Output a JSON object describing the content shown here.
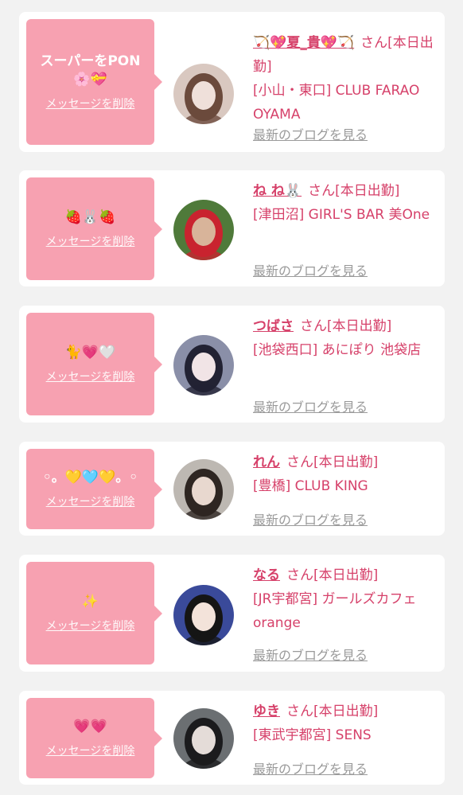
{
  "delete_label": "メッセージを削除",
  "blog_label": "最新のブログを見る",
  "honorific": "さん",
  "entries": [
    {
      "message": "スーパーをPON\n🌸💝",
      "name": "🏹💖夏_貴💖🏹",
      "status": "[本日出勤]",
      "shop": "[小山・東口] CLUB FARAO OYAMA",
      "avatar_colors": [
        "#d9c8c0",
        "#efe0da",
        "#6b4a3c"
      ]
    },
    {
      "message": "🍓🐰🍓",
      "name": "ね ね🐰",
      "status": "[本日出勤]",
      "shop": "[津田沼] GIRL'S BAR 美One",
      "avatar_colors": [
        "#4f7a3a",
        "#d8b49a",
        "#c9232f"
      ]
    },
    {
      "message": "🐈💗🤍",
      "name": "つばさ",
      "status": "[本日出勤]",
      "shop": "[池袋西口] あにぽり 池袋店",
      "avatar_colors": [
        "#8a8fa8",
        "#f1e4e6",
        "#222233"
      ]
    },
    {
      "message": "◦。💛🩵💛。◦",
      "name": "れん",
      "status": "[本日出勤]",
      "shop": "[豊橋] CLUB KING",
      "avatar_colors": [
        "#bdb8b2",
        "#e8d8cf",
        "#2e2622"
      ]
    },
    {
      "message": "✨",
      "name": "なる",
      "status": "[本日出勤]",
      "shop": "[JR宇都宮] ガールズカフェ orange",
      "avatar_colors": [
        "#3a4a9a",
        "#f3e3da",
        "#151515"
      ]
    },
    {
      "message": "💗💗",
      "name": "ゆき",
      "status": "[本日出勤]",
      "shop": "[東武宇都宮] SENS",
      "avatar_colors": [
        "#6b6f72",
        "#e4dcd8",
        "#1b1b1d"
      ]
    }
  ]
}
